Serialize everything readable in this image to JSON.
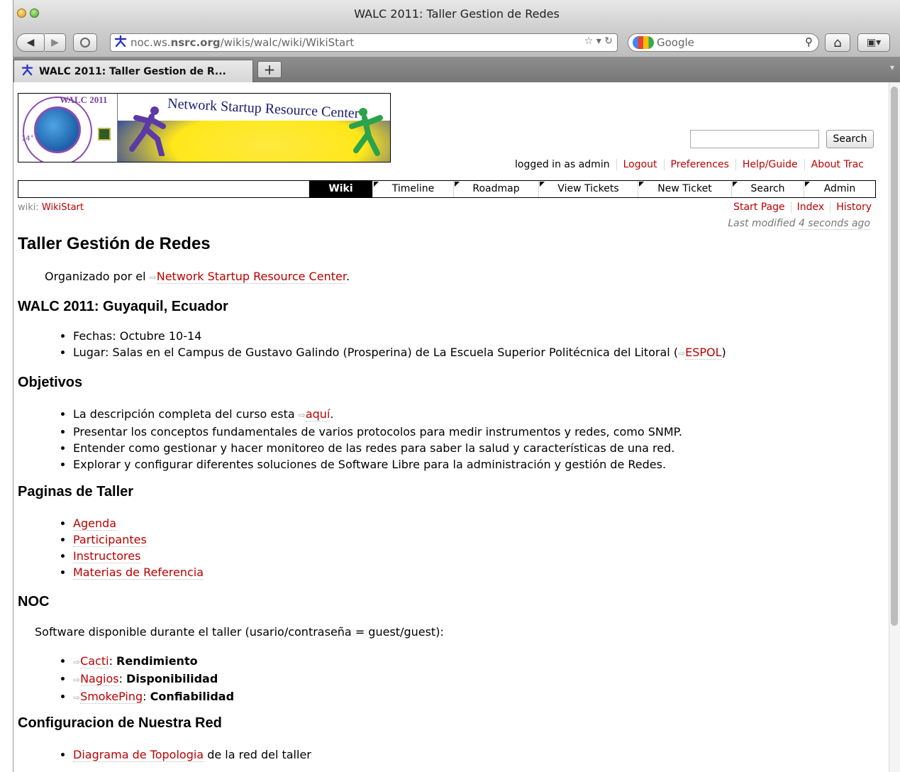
{
  "window": {
    "title": "WALC 2011: Taller Gestion de Redes"
  },
  "toolbar": {
    "url_prefix": "noc.ws.",
    "url_host": "nsrc.org",
    "url_path": "/wikis/walc/wiki/WikiStart",
    "search_placeholder": "Google",
    "back_glyph": "◀",
    "fwd_glyph": "▶",
    "home_glyph": "⌂"
  },
  "tabs": [
    {
      "label": "WALC 2011: Taller Gestion de R..."
    }
  ],
  "header": {
    "banner": {
      "walc_year": "WALC 2011",
      "nsrc_text": "Network Startup Resource Center",
      "edition": "14°"
    },
    "search_button": "Search",
    "metanav": {
      "logged_in": "logged in as admin",
      "logout": "Logout",
      "preferences": "Preferences",
      "help": "Help/Guide",
      "about": "About Trac"
    }
  },
  "mainnav": [
    "Wiki",
    "Timeline",
    "Roadmap",
    "View Tickets",
    "New Ticket",
    "Search",
    "Admin"
  ],
  "ctxnav": {
    "start": "Start Page",
    "index": "Index",
    "history": "History"
  },
  "breadcrumb": {
    "prefix": "wiki:",
    "page": "WikiStart"
  },
  "lastmod": {
    "prefix": "Last modified",
    "age": "4 seconds ago"
  },
  "content": {
    "title": "Taller Gestión de Redes",
    "org_prefix": "Organizado por el",
    "org_link": "Network Startup Resource Center",
    "org_suffix": ".",
    "walc_heading": "WALC 2011: Guyaquil, Ecuador",
    "walc_items": {
      "fechas": "Fechas: Octubre 10-14",
      "lugar_prefix": "Lugar: Salas en el Campus de Gustavo Galindo (Prosperina) de La Escuela Superior Politécnica del Litoral (",
      "lugar_link": "ESPOL",
      "lugar_suffix": ")"
    },
    "obj_heading": "Objetivos",
    "obj_items": {
      "desc_prefix": "La descripción completa del curso esta",
      "desc_link": "aquí",
      "desc_suffix": ".",
      "presentar": "Presentar los conceptos fundamentales de varios protocolos para medir instrumentos y redes, como SNMP.",
      "entender": "Entender como gestionar y hacer monitoreo de las redes para saber la salud y características de una red.",
      "explorar": "Explorar y configurar diferentes soluciones de Software Libre para la administración y gestión de Redes."
    },
    "pag_heading": "Paginas de Taller",
    "pag_items": [
      "Agenda",
      "Participantes",
      "Instructores",
      "Materias de Referencia"
    ],
    "noc_heading": "NOC",
    "noc_intro": "Software disponible durante el taller (usario/contraseña = guest/guest):",
    "noc_items": [
      {
        "link": "Cacti",
        "desc": "Rendimiento"
      },
      {
        "link": "Nagios",
        "desc": "Disponibilidad"
      },
      {
        "link": "SmokePing",
        "desc": "Confiabilidad"
      }
    ],
    "conf_heading": "Configuracion de Nuestra Red",
    "conf_link": "Diagrama de Topologia",
    "conf_suffix": "de la red del taller"
  }
}
